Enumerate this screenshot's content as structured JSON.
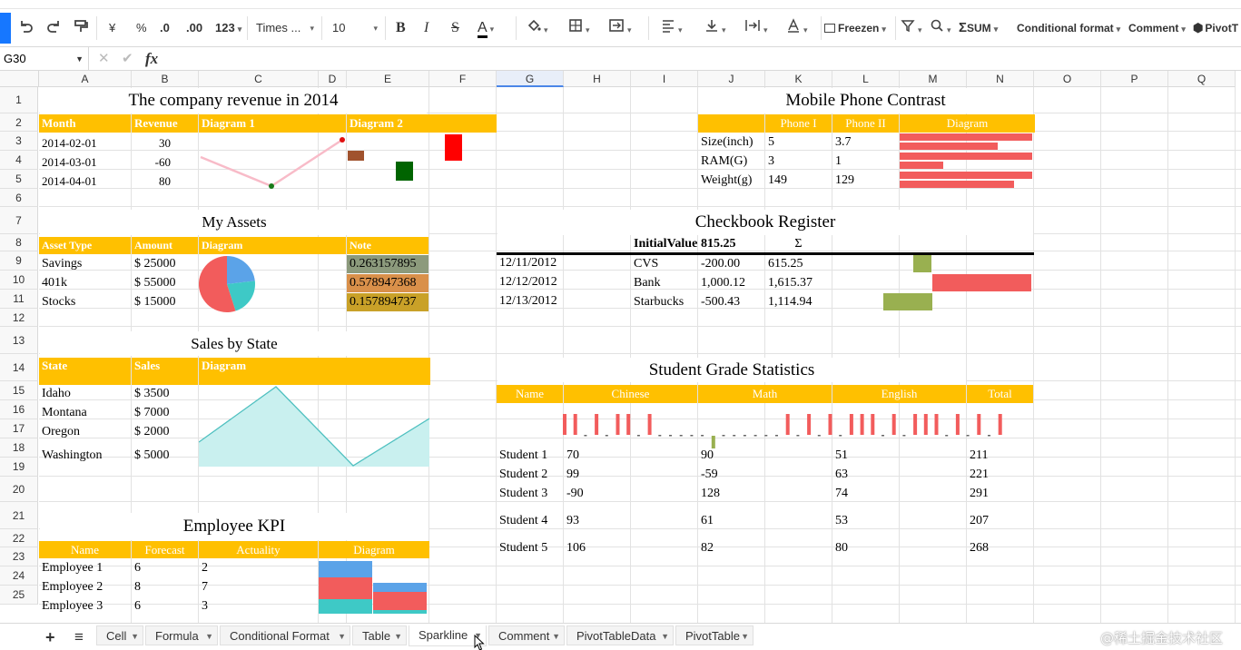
{
  "toolbar": {
    "currency": "¥",
    "percent": "%",
    "dec_decrease": ".0",
    "dec_increase": ".00",
    "number_format": "123",
    "font_family": "Times ...",
    "font_size": "10",
    "bold": "B",
    "italic": "I",
    "strike": "S",
    "text_color_glyph": "A",
    "freeze": "Freezen",
    "sum": "SUM",
    "conditional_format": "Conditional format",
    "comment": "Comment",
    "pivot": "PivotT"
  },
  "formula_bar": {
    "cell_ref": "G30",
    "fx": "fx"
  },
  "columns": [
    "A",
    "B",
    "C",
    "D",
    "E",
    "F",
    "G",
    "H",
    "I",
    "J",
    "K",
    "L",
    "M",
    "N",
    "O",
    "P",
    "Q"
  ],
  "selected_column": "G",
  "rows": [
    "1",
    "2",
    "3",
    "4",
    "5",
    "6",
    "7",
    "8",
    "9",
    "10",
    "11",
    "12",
    "13",
    "14",
    "15",
    "16",
    "17",
    "18",
    "19",
    "20",
    "21",
    "22",
    "23",
    "24",
    "25"
  ],
  "revenue": {
    "title": "The company revenue in 2014",
    "headers": [
      "Month",
      "Revenue",
      "Diagram 1",
      "Diagram 2"
    ],
    "rows": [
      {
        "month": "2014-02-01",
        "revenue": "30"
      },
      {
        "month": "2014-03-01",
        "revenue": "-60"
      },
      {
        "month": "2014-04-01",
        "revenue": "80"
      }
    ],
    "line_color": "#f8bbc8",
    "bar_colors": [
      "#a0522d",
      "#006400",
      "#ff0000"
    ]
  },
  "assets": {
    "title": "My Assets",
    "headers": [
      "Asset Type",
      "Amount",
      "Diagram",
      "Note"
    ],
    "rows": [
      {
        "type": "Savings",
        "amount": "$ 25000",
        "note": "0.263157895",
        "note_color": "#8c9a7c"
      },
      {
        "type": "401k",
        "amount": "$ 55000",
        "note": "0.578947368",
        "note_color": "#d9904a"
      },
      {
        "type": "Stocks",
        "amount": "$ 15000",
        "note": "0.157894737",
        "note_color": "#c9a128"
      }
    ],
    "pie_colors": [
      "#5ba3e8",
      "#3ec9c6",
      "#f25c5c"
    ]
  },
  "sales": {
    "title": "Sales by State",
    "headers": [
      "State",
      "Sales",
      "Diagram"
    ],
    "rows": [
      {
        "state": "Idaho",
        "sales": "$ 3500"
      },
      {
        "state": "Montana",
        "sales": "$ 7000"
      },
      {
        "state": "Oregon",
        "sales": "$ 2000"
      },
      {
        "state": "Washington",
        "sales": "$ 5000"
      }
    ],
    "values": [
      3500,
      7000,
      2000,
      5000
    ],
    "area_color": "#c9f0ef",
    "line_color": "#4fc0c0"
  },
  "kpi": {
    "title": "Employee KPI",
    "headers": [
      "Name",
      "Forecast",
      "Actuality",
      "Diagram"
    ],
    "rows": [
      {
        "name": "Employee 1",
        "forecast": "6",
        "actual": "2"
      },
      {
        "name": "Employee 2",
        "forecast": "8",
        "actual": "7"
      },
      {
        "name": "Employee 3",
        "forecast": "6",
        "actual": "3"
      }
    ],
    "colors": [
      "#5ba3e8",
      "#f25c5c",
      "#3ec9c6"
    ]
  },
  "phones": {
    "title": "Mobile Phone Contrast",
    "headers": [
      "",
      "Phone I",
      "Phone II",
      "Diagram"
    ],
    "rows": [
      {
        "label": "Size(inch)",
        "p1": "5",
        "p2": "3.7"
      },
      {
        "label": "RAM(G)",
        "p1": "3",
        "p2": "1"
      },
      {
        "label": "Weight(g)",
        "p1": "149",
        "p2": "129"
      }
    ],
    "bar_color": "#f25c5c"
  },
  "checkbook": {
    "title": "Checkbook Register",
    "initial_label": "InitialValue",
    "initial_value": "815.25",
    "sigma": "Σ",
    "rows": [
      {
        "date": "12/11/2012",
        "payee": "CVS",
        "amount": "-200.00",
        "balance": "615.25"
      },
      {
        "date": "12/12/2012",
        "payee": "Bank",
        "amount": "1,000.12",
        "balance": "1,615.37"
      },
      {
        "date": "12/13/2012",
        "payee": "Starbucks",
        "amount": "-500.43",
        "balance": "1,114.94"
      }
    ],
    "pos_color": "#f25c5c",
    "neg_color": "#99b050"
  },
  "grades": {
    "title": "Student Grade Statistics",
    "headers": [
      "Name",
      "Chinese",
      "Math",
      "English",
      "Total"
    ],
    "rows": [
      {
        "name": "Student 1",
        "chinese": "70",
        "math": "90",
        "english": "51",
        "total": "211"
      },
      {
        "name": "Student 2",
        "chinese": "99",
        "math": "-59",
        "english": "63",
        "total": "221"
      },
      {
        "name": "Student 3",
        "chinese": "-90",
        "math": "128",
        "english": "74",
        "total": "291"
      },
      {
        "name": "Student 4",
        "chinese": "93",
        "math": "61",
        "english": "53",
        "total": "207"
      },
      {
        "name": "Student 5",
        "chinese": "106",
        "math": "82",
        "english": "80",
        "total": "268"
      }
    ],
    "pos_color": "#f25c5c",
    "neg_color": "#99b050"
  },
  "sheet_tabs": [
    {
      "label": "Cell",
      "active": false
    },
    {
      "label": "Formula",
      "active": false
    },
    {
      "label": "Conditional Format",
      "active": false
    },
    {
      "label": "Table",
      "active": false
    },
    {
      "label": "Sparkline",
      "active": true
    },
    {
      "label": "Comment",
      "active": false
    },
    {
      "label": "PivotTableData",
      "active": false
    },
    {
      "label": "PivotTable",
      "active": false
    }
  ],
  "add_sheet": "+",
  "sheet_menu": "≡",
  "watermark": "@稀土掘金技术社区",
  "header_color": "#ffc000"
}
